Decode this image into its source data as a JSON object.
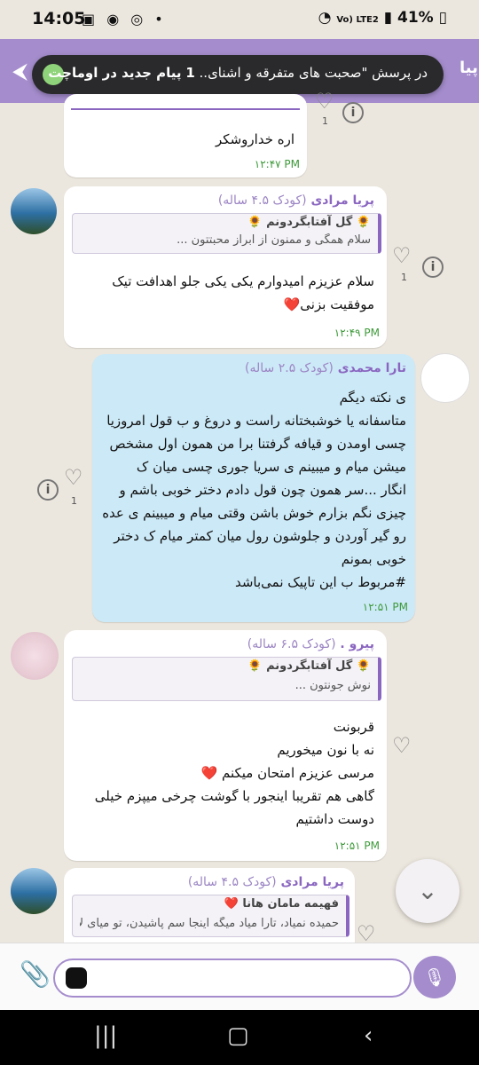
{
  "status": {
    "time": "14:05",
    "battery": "41%",
    "network": "Vo) LTE2"
  },
  "toast": {
    "prefix": "در پرسش \"صحبت های متفرقه و اشنای..",
    "count": "1",
    "suffix": "پیام جدید در اوماچت"
  },
  "topbar": {
    "edge_text": "پیا"
  },
  "messages": [
    {
      "id": "m0",
      "body": "اره خداروشکر",
      "time": "۱۲:۴۷ PM",
      "like_count": "1"
    },
    {
      "id": "m1",
      "sender": "پریا مرادی",
      "sender_tag": "(کودک ۴.۵ ساله)",
      "reply_name": "🌻 گل آفتابگردونم 🌻",
      "reply_text": "سلام همگی و ممنون از ابراز محبتتون ...",
      "body": "سلام عزیزم امیدوارم یکی یکی جلو اهدافت تیک موفقیت بزنی❤️",
      "time": "۱۲:۴۹ PM",
      "like_count": "1"
    },
    {
      "id": "m2",
      "sender": "تارا محمدی",
      "sender_tag": "(کودک ۲.۵ ساله)",
      "body_lines": [
        "ی نکته دیگم",
        "متاسفانه یا خوشبختانه راست و دروغ و ب قول امروزیا",
        "چسی اومدن و قیافه گرفتنا برا من همون اول مشخص",
        "میشن میام و میبینم ی سریا جوری چسی میان ک",
        "انگار ...سر همون چون قول دادم دختر خوبی باشم و",
        "چیزی نگم بزارم خوش باشن وقتی میام و میبینم ی عده",
        "رو گیر آوردن و جلوشون رول میان کمتر میام ک دختر",
        "خوبی بمونم",
        "#مربوط ب این تاپیک نمی‌باشد"
      ],
      "time": "۱۲:۵۱ PM",
      "like_count": "1"
    },
    {
      "id": "m3",
      "sender": "پیرو .",
      "sender_tag": "(کودک ۶.۵ ساله)",
      "reply_name": "🌻 گل آفتابگردونم 🌻",
      "reply_text": "نوش جونتون ...",
      "body_lines": [
        "قربونت",
        "نه با نون میخوریم",
        "مرسی عزیزم امتحان میکنم ❤️",
        "گاهی هم تقریبا اینجور با گوشت چرخی میپزم خیلی",
        "دوست داشتیم"
      ],
      "time": "۱۲:۵۱ PM"
    },
    {
      "id": "m4",
      "sender": "پریا مرادی",
      "sender_tag": "(کودک ۴.۵ ساله)",
      "reply_name": "فهیمه مامان هانا ❤️",
      "reply_text": "حمیده نمیاد، تارا میاد میگه اینجا سم پاشیدن، تو میای لا..."
    }
  ],
  "icons": {
    "back": "back-arrow-icon",
    "attach": "paperclip-icon",
    "mic": "microphone-icon",
    "scroll": "chevron-down-icon"
  },
  "colors": {
    "accent": "#a58dcd",
    "outgoing": "#cce9f7",
    "time": "#3e9a3a"
  }
}
